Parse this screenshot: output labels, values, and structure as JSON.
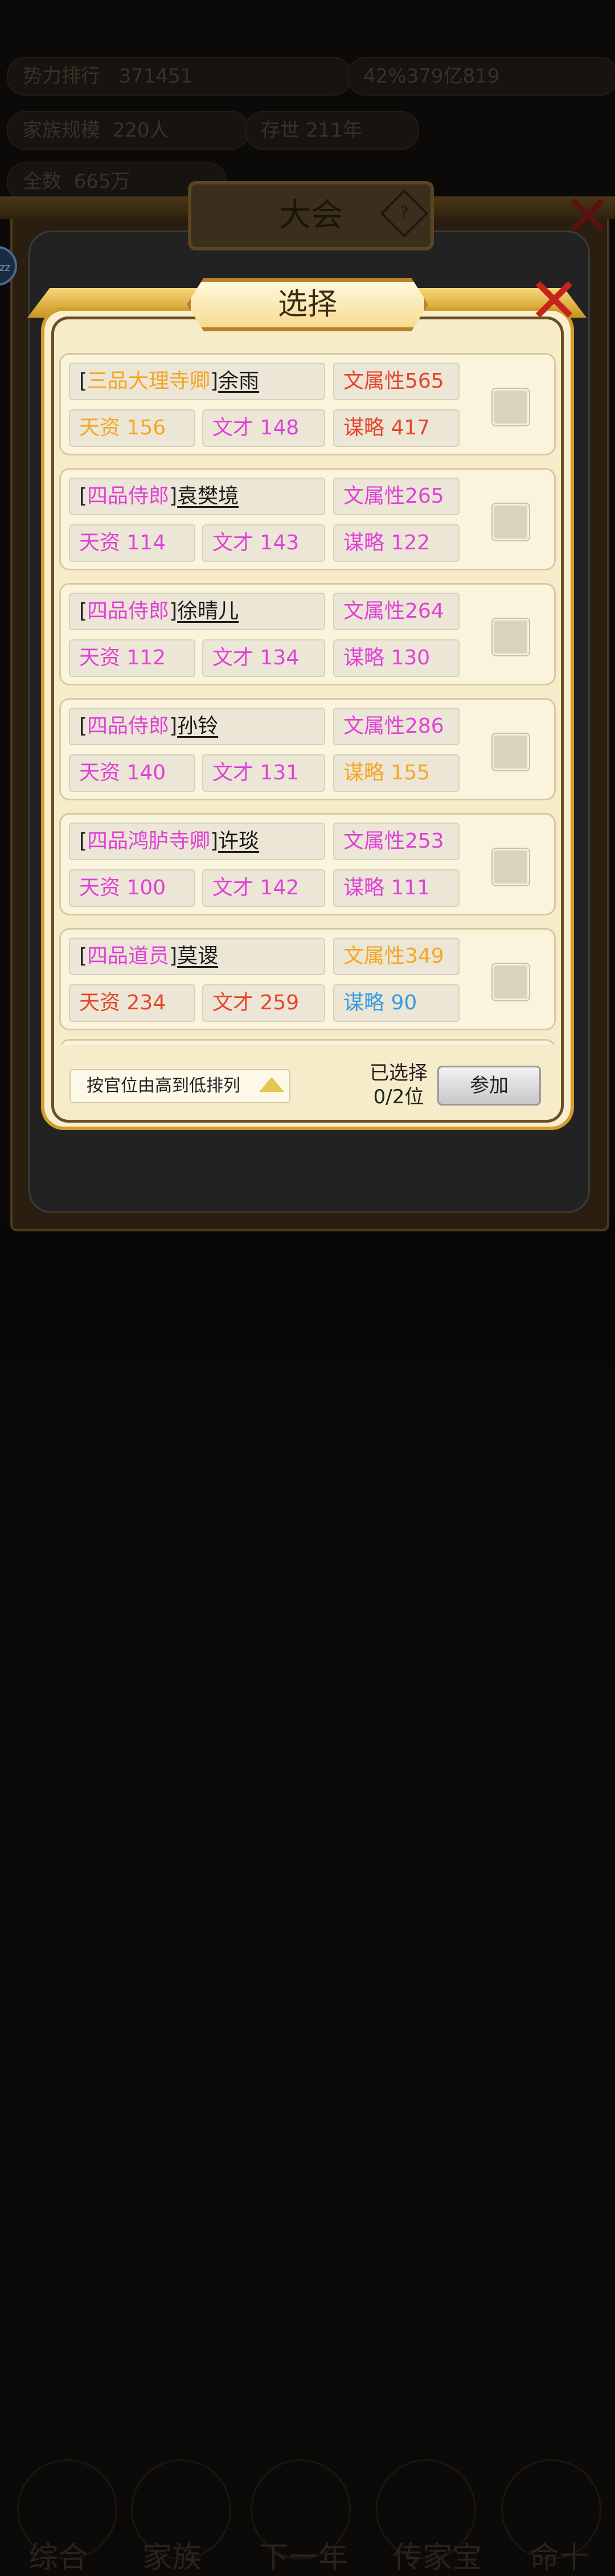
{
  "background": {
    "top_pills": [
      "势力排行",
      "371451",
      "42%379亿819",
      "家族规模",
      "220人",
      "存世",
      "211年",
      "全数",
      "665万"
    ],
    "nav": [
      "综合",
      "家族",
      "下一年",
      "传家宝",
      "命十"
    ]
  },
  "outer_dialog": {
    "title": "大会",
    "help_icon": "?",
    "bubble_text": "zz"
  },
  "select_dialog": {
    "title": "选择",
    "candidates": [
      {
        "rank": "三品大理寺卿",
        "name": "余雨",
        "attribute": "文属性565",
        "talent": "天资 156",
        "literary": "文才 148",
        "strategy": "谋略 417",
        "rank_color": "#f5a623",
        "attr_color": "#e8432a",
        "talent_color": "#f5a623",
        "literary_color": "#e040d8",
        "strategy_color": "#e8432a"
      },
      {
        "rank": "四品侍郎",
        "name": "袁樊境",
        "attribute": "文属性265",
        "talent": "天资 114",
        "literary": "文才 143",
        "strategy": "谋略 122",
        "rank_color": "#e040d8",
        "attr_color": "#e040d8",
        "talent_color": "#e040d8",
        "literary_color": "#e040d8",
        "strategy_color": "#e040d8"
      },
      {
        "rank": "四品侍郎",
        "name": "徐晴儿",
        "attribute": "文属性264",
        "talent": "天资 112",
        "literary": "文才 134",
        "strategy": "谋略 130",
        "rank_color": "#e040d8",
        "attr_color": "#e040d8",
        "talent_color": "#e040d8",
        "literary_color": "#e040d8",
        "strategy_color": "#e040d8"
      },
      {
        "rank": "四品侍郎",
        "name": "孙铃",
        "attribute": "文属性286",
        "talent": "天资 140",
        "literary": "文才 131",
        "strategy": "谋略 155",
        "rank_color": "#e040d8",
        "attr_color": "#e040d8",
        "talent_color": "#e040d8",
        "literary_color": "#e040d8",
        "strategy_color": "#f5a623"
      },
      {
        "rank": "四品鸿胪寺卿",
        "name": "许琰",
        "attribute": "文属性253",
        "talent": "天资 100",
        "literary": "文才 142",
        "strategy": "谋略 111",
        "rank_color": "#e040d8",
        "attr_color": "#e040d8",
        "talent_color": "#e040d8",
        "literary_color": "#e040d8",
        "strategy_color": "#e040d8"
      },
      {
        "rank": "四品道员",
        "name": "莫谡",
        "attribute": "文属性349",
        "talent": "天资 234",
        "literary": "文才 259",
        "strategy": "谋略 90",
        "rank_color": "#e040d8",
        "attr_color": "#f5a623",
        "talent_color": "#e8432a",
        "literary_color": "#e8432a",
        "strategy_color": "#3a9be0"
      }
    ],
    "sort_label": "按官位由高到低排列",
    "selected_label": "已选择",
    "selected_count": "0/2位",
    "join_label": "参加"
  }
}
